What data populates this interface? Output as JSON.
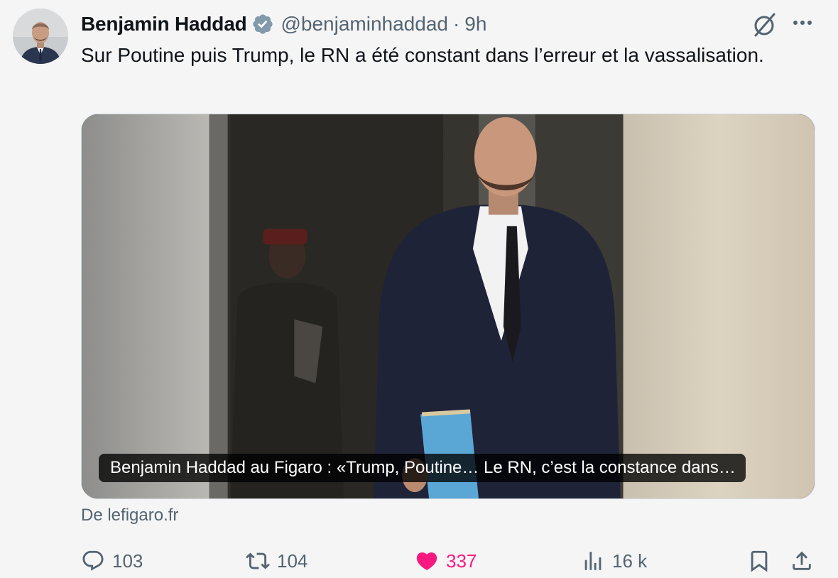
{
  "author": {
    "name": "Benjamin Haddad",
    "handle": "@benjaminhaddad",
    "separator": "·",
    "time": "9h",
    "verified_color": "#829aab"
  },
  "tweet": {
    "text": "Sur Poutine puis Trump, le RN a été constant dans l’erreur et la vassalisation."
  },
  "card": {
    "caption": "Benjamin Haddad au Figaro : «Trump, Poutine… Le RN, c’est la constance dans…",
    "source": "De lefigaro.fr"
  },
  "actions": {
    "replies": "103",
    "reposts": "104",
    "likes": "337",
    "views": "16 k",
    "like_color": "#f91880"
  },
  "icons": {
    "verified": "verified-badge-icon",
    "grok": "grok-icon",
    "more": "more-icon",
    "reply": "reply-icon",
    "repost": "repost-icon",
    "like": "heart-icon",
    "views": "views-icon",
    "bookmark": "bookmark-icon",
    "share": "share-icon"
  }
}
